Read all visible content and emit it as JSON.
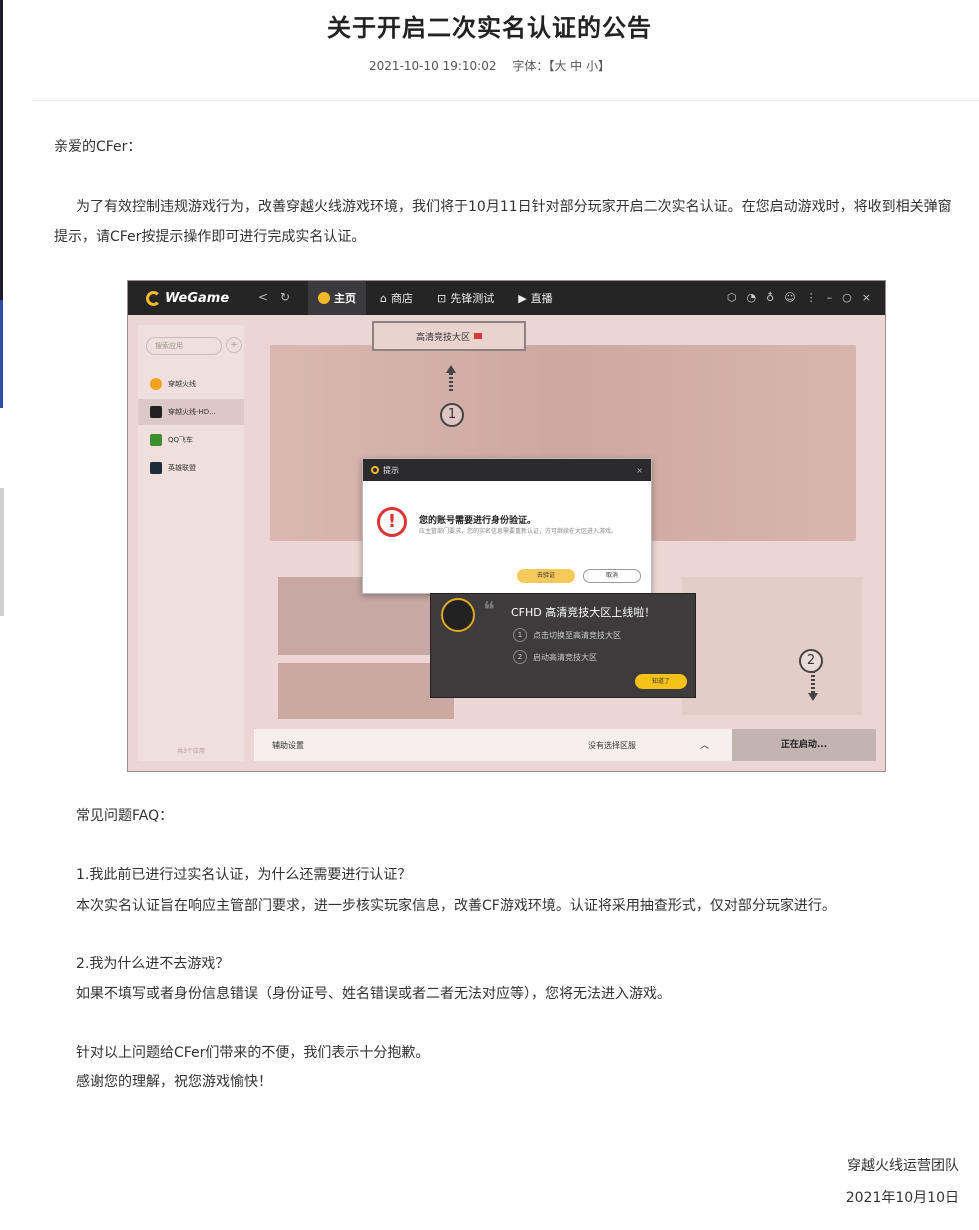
{
  "article": {
    "title": "关于开启二次实名认证的公告",
    "datetime": "2021-10-10 19:10:02",
    "font_label": "字体：【大 中 小】",
    "greeting": "亲爱的CFer：",
    "intro": "为了有效控制违规游戏行为，改善穿越火线游戏环境，我们将于10月11日针对部分玩家开启二次实名认证。在您启动游戏时，将收到相关弹窗提示，请CFer按提示操作即可进行完成实名认证。",
    "faq_heading": "常见问题FAQ：",
    "q1": "1.我此前已进行过实名认证，为什么还需要进行认证？",
    "a1": "本次实名认证旨在响应主管部门要求，进一步核实玩家信息，改善CF游戏环境。认证将采用抽查形式，仅对部分玩家进行。",
    "q2": "2.我为什么进不去游戏？",
    "a2": "如果不填写或者身份信息错误（身份证号、姓名错误或者二者无法对应等），您将无法进入游戏。",
    "apology": "针对以上问题给CFer们带来的不便，我们表示十分抱歉。",
    "thanks": "感谢您的理解，祝您游戏愉快！",
    "signature": "穿越火线运营团队",
    "sign_date": "2021年10月10日"
  },
  "screenshot": {
    "logo": "WeGame",
    "nav": {
      "back": "<",
      "refresh": "↻",
      "home": "主页",
      "store": "商店",
      "beta": "先锋测试",
      "live": "直播"
    },
    "top_icons": [
      "⬡",
      "◔",
      "♁",
      "☺",
      "⋮",
      "–",
      "○",
      "×"
    ],
    "sidebar": {
      "search_placeholder": "搜索应用",
      "plus": "+",
      "games": [
        "穿越火线",
        "穿越火线-HD...",
        "QQ飞车",
        "英雄联盟"
      ],
      "footer": "共3个应用"
    },
    "region_box": "高清竞技大区",
    "badge_1": "1",
    "badge_2": "2",
    "dialog": {
      "header": "提示",
      "close": "×",
      "title": "您的账号需要进行身份验证。",
      "desc": "应主管部门要求，您的实名信息需要重新认证，方可继续在大区进入游戏。",
      "confirm": "去验证",
      "cancel": "取消"
    },
    "popup": {
      "title": "CFHD 高清竞技大区上线啦！",
      "step1": "点击切换至高清竞技大区",
      "step2": "启动高清竞技大区",
      "button": "知道了"
    },
    "bottombar": {
      "guide": "辅助设置",
      "region": "没有选择区服",
      "chevron": "︿",
      "launch": "正在启动..."
    }
  },
  "colors": {
    "accent_yellow": "#f5c21a",
    "warning_red": "#dd3333",
    "titlebar": "#252526"
  }
}
